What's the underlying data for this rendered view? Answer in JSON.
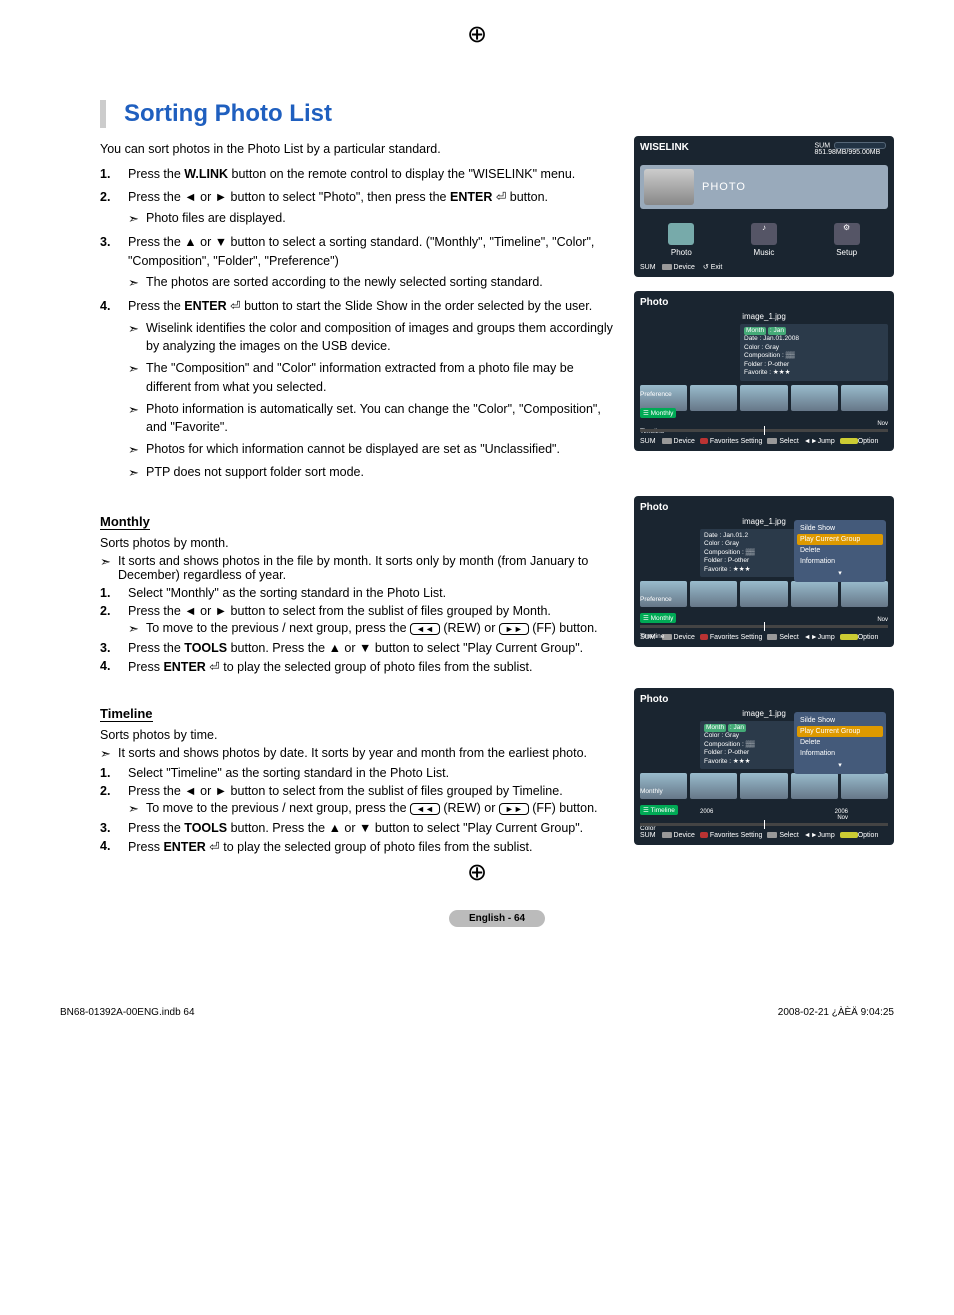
{
  "title": "Sorting Photo List",
  "intro": "You can sort photos in the Photo List by a particular standard.",
  "steps_main": [
    {
      "num": "1.",
      "text_a": "Press the ",
      "bold_a": "W.LINK",
      "text_b": " button on the remote control to display the \"WISELINK\" menu."
    },
    {
      "num": "2.",
      "text_a": "Press the ◄ or ► button to select \"Photo\", then press the ",
      "bold_a": "ENTER",
      "text_b": " ⏎ button.",
      "subs": [
        "Photo files are displayed."
      ]
    },
    {
      "num": "3.",
      "text_a": "Press the ▲ or ▼ button to select a sorting standard. (\"Monthly\", \"Timeline\", \"Color\", \"Composition\", \"Folder\", \"Preference\")",
      "subs": [
        "The photos are sorted according to the newly selected sorting standard."
      ]
    },
    {
      "num": "4.",
      "text_a": "Press the ",
      "bold_a": "ENTER",
      "text_b": " ⏎ button to start the Slide Show in the order selected by the user.",
      "subs": [
        "Wiselink identifies the color and composition of images and groups them accordingly by analyzing the images on the USB device.",
        "The \"Composition\" and \"Color\" information extracted from a photo file may be different from what you selected.",
        "Photo information is automatically set. You can change the \"Color\", \"Composition\", and \"Favorite\".",
        "Photos for which information cannot be displayed are set as \"Unclassified\".",
        "PTP does not support folder sort mode."
      ]
    }
  ],
  "monthly": {
    "label": "Monthly",
    "intro": "Sorts photos by month.",
    "sub0": "It sorts and shows photos in the file by month. It sorts only by month (from January to December) regardless of year.",
    "steps": [
      {
        "num": "1.",
        "text": "Select \"Monthly\" as the sorting standard in the Photo List."
      },
      {
        "num": "2.",
        "text": "Press the ◄ or ► button to select from the sublist of files grouped by Month.",
        "sub_prefix": "To move to the previous / next group, press the ",
        "rew": "◄◄",
        "rew_lbl": " (REW) or ",
        "ff": "►►",
        "ff_lbl": " (FF) button."
      },
      {
        "num": "3.",
        "text_a": "Press the ",
        "bold": "TOOLS",
        "text_b": " button. Press the ▲ or ▼ button to select \"Play Current Group\"."
      },
      {
        "num": "4.",
        "text_a": "Press ",
        "bold": "ENTER",
        "text_b": " ⏎ to play the selected group of photo files from the sublist."
      }
    ]
  },
  "timeline": {
    "label": "Timeline",
    "intro": "Sorts photos by time.",
    "sub0": "It sorts and shows photos by date. It sorts by year and month from the earliest photo.",
    "steps": [
      {
        "num": "1.",
        "text": "Select \"Timeline\" as the sorting standard in the Photo List."
      },
      {
        "num": "2.",
        "text": "Press the ◄ or ► button to select from the sublist of files grouped by Timeline.",
        "sub_prefix": "To move to the previous / next group, press the ",
        "rew": "◄◄",
        "rew_lbl": " (REW) or ",
        "ff": "►►",
        "ff_lbl": " (FF) button."
      },
      {
        "num": "3.",
        "text_a": "Press the ",
        "bold": "TOOLS",
        "text_b": " button. Press the ▲ or ▼ button to select \"Play Current Group\"."
      },
      {
        "num": "4.",
        "text_a": "Press ",
        "bold": "ENTER",
        "text_b": " ⏎ to play the selected group of photo files from the sublist."
      }
    ]
  },
  "shot_wiselink": {
    "title": "WISELINK",
    "storage": "851.98MB/995.00MB",
    "sum_lbl": "SUM",
    "photo_big": "PHOTO",
    "nav": {
      "photo": "Photo",
      "music": "Music",
      "setup": "Setup"
    },
    "foot": {
      "sum": "SUM",
      "device": "Device",
      "exit": "Exit"
    }
  },
  "shot_photo_common": {
    "title": "Photo",
    "file": "image_1.jpg",
    "meta_labels": {
      "month": "Month",
      "date": "Date",
      "color": "Color",
      "comp": "Composition",
      "folder": "Folder",
      "fav": "Favorite"
    },
    "meta_values": {
      "month": ": Jan",
      "date": ": Jan.01.2008",
      "color": ": Gray",
      "comp": ": ▒▒",
      "folder": ": P-other",
      "fav": ": ★★★"
    },
    "side": {
      "pref": "Preference",
      "monthly": "Monthly",
      "timeline": "Timeline",
      "color": "Color"
    },
    "tl": {
      "left": "2006",
      "right_top": "2006",
      "right_bot": "Nov"
    },
    "foot": {
      "sum": "SUM",
      "device": "Device",
      "favset": "Favorites Setting",
      "select": "Select",
      "jump": "Jump",
      "option": "Option"
    },
    "menu": {
      "slide": "Silde Show",
      "play": "Play Current Group",
      "delete": "Delete",
      "info": "Information"
    }
  },
  "footer": {
    "page": "English - 64",
    "left": "BN68-01392A-00ENG.indb   64",
    "right": "2008-02-21   ¿ÀÈÄ 9:04:25"
  }
}
